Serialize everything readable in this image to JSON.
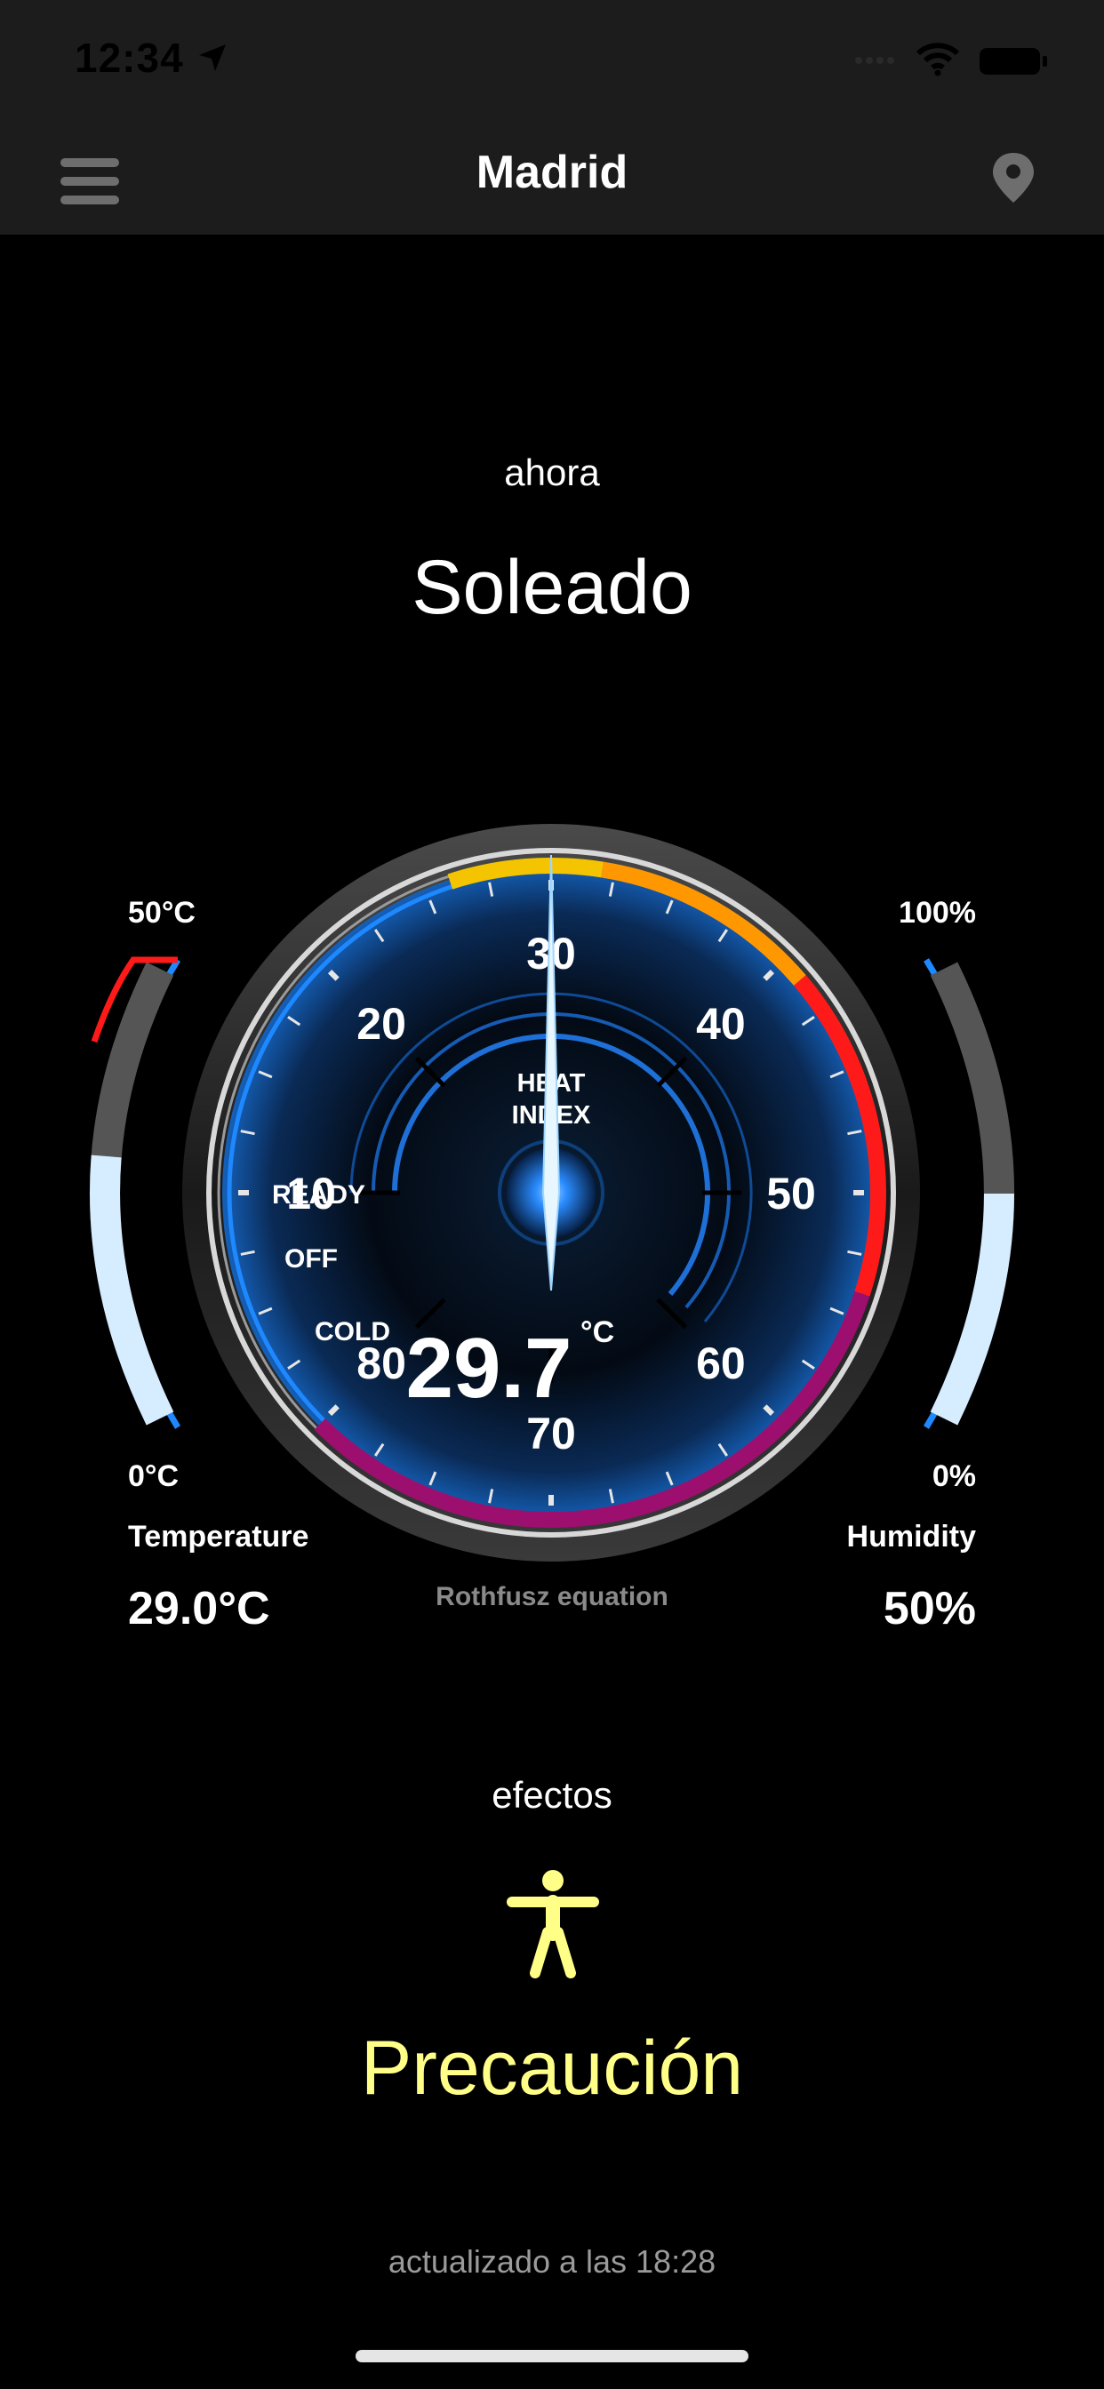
{
  "status_bar": {
    "time": "12:34",
    "icons": [
      "location-arrow-icon",
      "signal-icon",
      "wifi-icon",
      "battery-icon"
    ]
  },
  "nav": {
    "title": "Madrid",
    "menu_icon": "hamburger-menu-icon",
    "location_icon": "map-pin-icon"
  },
  "now": {
    "label": "ahora",
    "condition": "Soleado"
  },
  "gauge": {
    "title_line1": "HEAT",
    "title_line2": "INDEX",
    "value": "29.7",
    "unit": "°C",
    "needle_value": 30,
    "scale_min": 0,
    "scale_max": 80,
    "ticks": [
      "10",
      "20",
      "30",
      "40",
      "50",
      "60",
      "70",
      "80"
    ],
    "states": [
      "READY",
      "OFF",
      "COLD"
    ],
    "zone_colors": {
      "caution": "#f5c400",
      "extreme_caution": "#ff9800",
      "danger": "#ff1a1a",
      "extreme_danger": "#9c0f6e",
      "ring": "#1e88ff"
    }
  },
  "temperature": {
    "max_label": "50°C",
    "min_label": "0°C",
    "title": "Temperature",
    "value": "29.0°C",
    "fill_fraction": 0.58
  },
  "humidity": {
    "max_label": "100%",
    "min_label": "0%",
    "title": "Humidity",
    "value": "50%",
    "fill_fraction": 0.5
  },
  "equation": "Rothfusz equation",
  "effects": {
    "label": "efectos",
    "icon": "person-standing-icon",
    "level": "Precaución",
    "color": "#ffff88"
  },
  "updated": "actualizado a las 18:28"
}
